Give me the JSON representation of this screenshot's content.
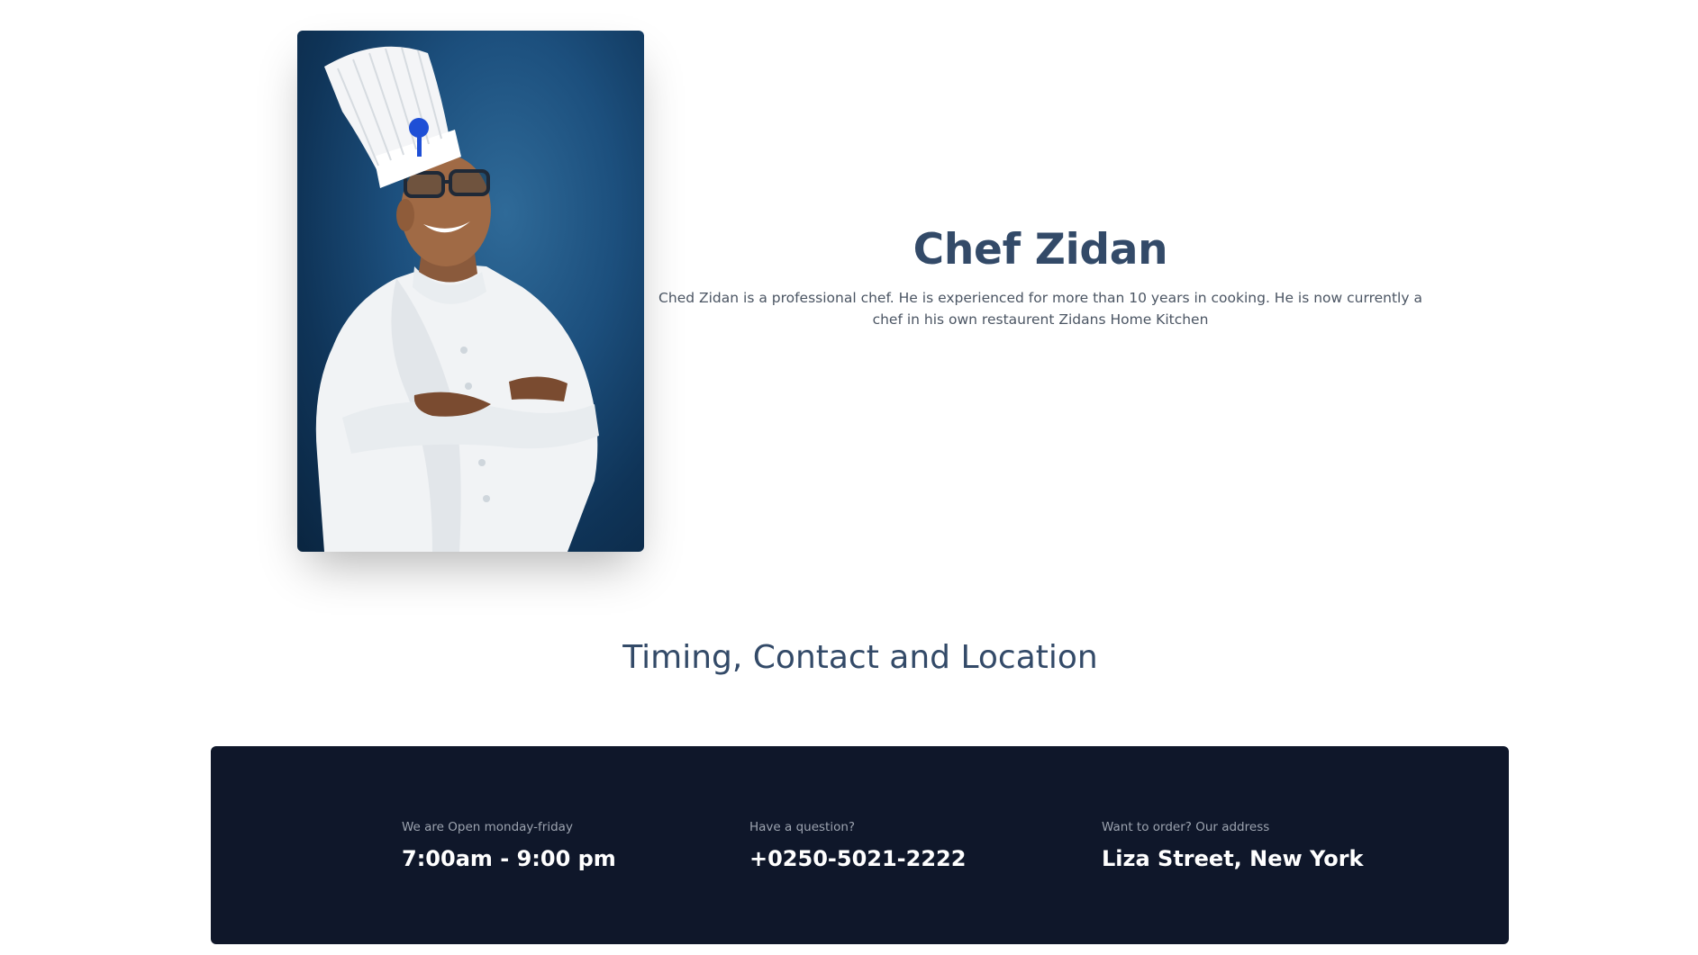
{
  "chef": {
    "name": "Chef Zidan",
    "bio": "Ched Zidan is a professional chef. He is experienced for more than 10 years in cooking. He is now currently a chef in his own restaurent Zidans Home Kitchen",
    "photo_alt": "chef-portrait"
  },
  "section": {
    "title": "Timing, Contact and Location"
  },
  "info": {
    "hours_label": "We are Open monday-friday",
    "hours_value": "7:00am - 9:00 pm",
    "contact_label": "Have a question?",
    "contact_value": "+0250-5021-2222",
    "address_label": "Want to order? Our address",
    "address_value": "Liza Street, New York"
  },
  "colors": {
    "heading": "#334a68",
    "banner_bg": "#0f172a",
    "photo_bg": "#1c4f7d"
  }
}
